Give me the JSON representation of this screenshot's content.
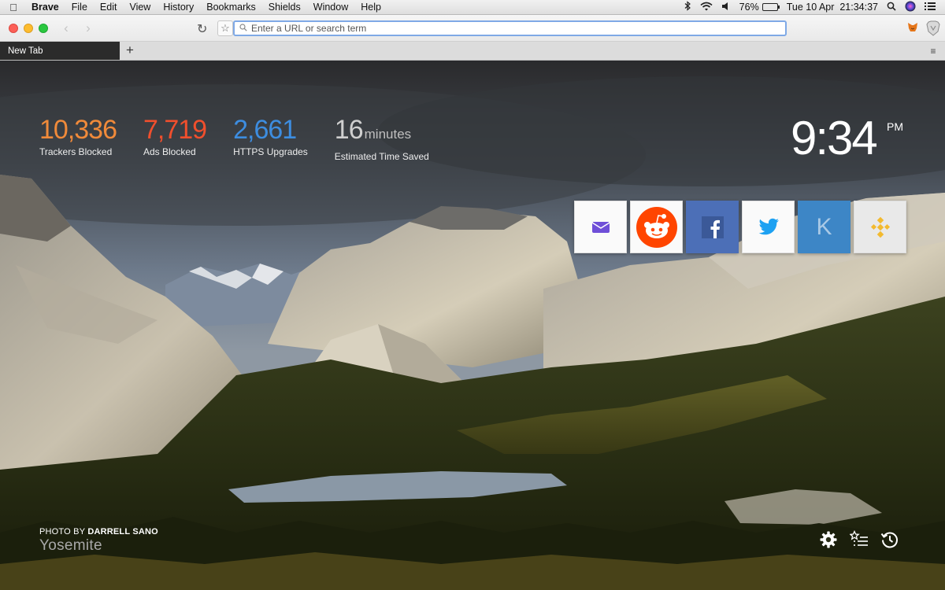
{
  "menubar": {
    "apple_icon": "apple-icon",
    "app_name": "Brave",
    "menus": [
      "File",
      "Edit",
      "View",
      "History",
      "Bookmarks",
      "Shields",
      "Window",
      "Help"
    ],
    "battery_percent": "76%",
    "battery_level": 0.76,
    "clock": "Tue 10 Apr  21:34:37"
  },
  "toolbar": {
    "url_placeholder": "Enter a URL or search term",
    "url_value": ""
  },
  "tabs": {
    "active_tab": "New Tab",
    "new_tab_glyph": "+",
    "menu_glyph": "≡"
  },
  "stats": [
    {
      "value": "10,336",
      "unit": "",
      "label": "Trackers Blocked",
      "color": "#f08a3a"
    },
    {
      "value": "7,719",
      "unit": "",
      "label": "Ads Blocked",
      "color": "#f04f2d"
    },
    {
      "value": "2,661",
      "unit": "",
      "label": "HTTPS Upgrades",
      "color": "#3d8de0"
    },
    {
      "value": "16",
      "unit": "minutes",
      "label": "Estimated Time Saved",
      "color": "#cfcfcf"
    }
  ],
  "time": {
    "value": "9:34",
    "ampm": "PM"
  },
  "top_sites": [
    "yahoo-mail",
    "reddit",
    "facebook",
    "twitter",
    "k-site",
    "binance"
  ],
  "top_site_k_letter": "K",
  "photo": {
    "prefix": "PHOTO BY ",
    "photographer": "DARRELL SANO",
    "location": "Yosemite"
  }
}
